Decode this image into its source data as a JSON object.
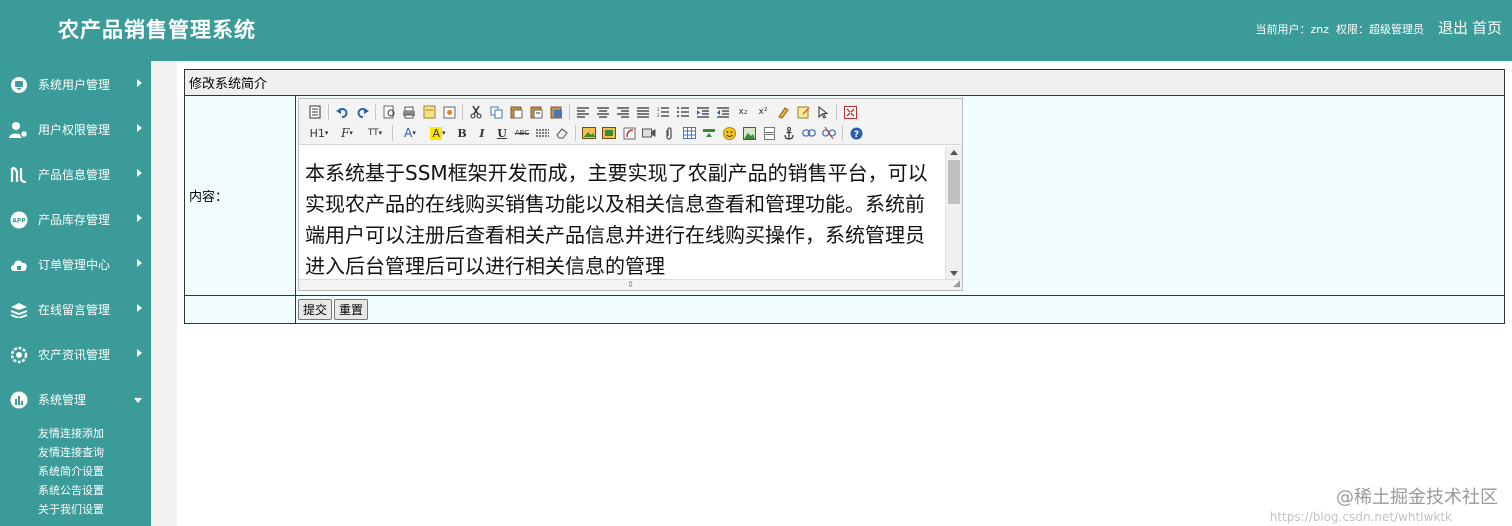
{
  "header": {
    "title": "农产品销售管理系统",
    "current_user_label": "当前用户：",
    "current_user": "znz",
    "permission_label": "权限：",
    "permission": "超级管理员",
    "logout": "退出",
    "home": "首页"
  },
  "sidebar": {
    "items": [
      {
        "label": "系统用户管理",
        "icon": "monitor-icon"
      },
      {
        "label": "用户权限管理",
        "icon": "user-gear-icon"
      },
      {
        "label": "产品信息管理",
        "icon": "product-icon"
      },
      {
        "label": "产品库存管理",
        "icon": "app-icon"
      },
      {
        "label": "订单管理中心",
        "icon": "cloud-icon"
      },
      {
        "label": "在线留言管理",
        "icon": "layers-icon"
      },
      {
        "label": "农产资讯管理",
        "icon": "gear-icon"
      },
      {
        "label": "系统管理",
        "icon": "chart-icon"
      }
    ],
    "submenu": [
      "友情连接添加",
      "友情连接查询",
      "系统简介设置",
      "系统公告设置",
      "关于我们设置"
    ]
  },
  "form": {
    "title": "修改系统简介",
    "content_label": "内容：",
    "content_text": "本系统基于SSM框架开发而成，主要实现了农副产品的销售平台，可以实现农产品的在线购买销售功能以及相关信息查看和管理功能。系统前端用户可以注册后查看相关产品信息并进行在线购买操作，系统管理员进入后台管理后可以进行相关信息的管理",
    "submit_label": "提交",
    "reset_label": "重置"
  },
  "toolbar": {
    "heading": "H1",
    "font_family": "F",
    "font_size": "TT",
    "font_color": "A",
    "bg_color": "A",
    "bold": "B",
    "italic": "I",
    "underline": "U",
    "strike": "ABC",
    "subscript": "x₂",
    "superscript": "x²"
  },
  "watermark": {
    "text": "@稀土掘金技术社区",
    "url": "https://blog.csdn.net/whtlwktk"
  },
  "colors": {
    "brand": "#3a9b98",
    "panel_bg": "#f2fdfd"
  }
}
